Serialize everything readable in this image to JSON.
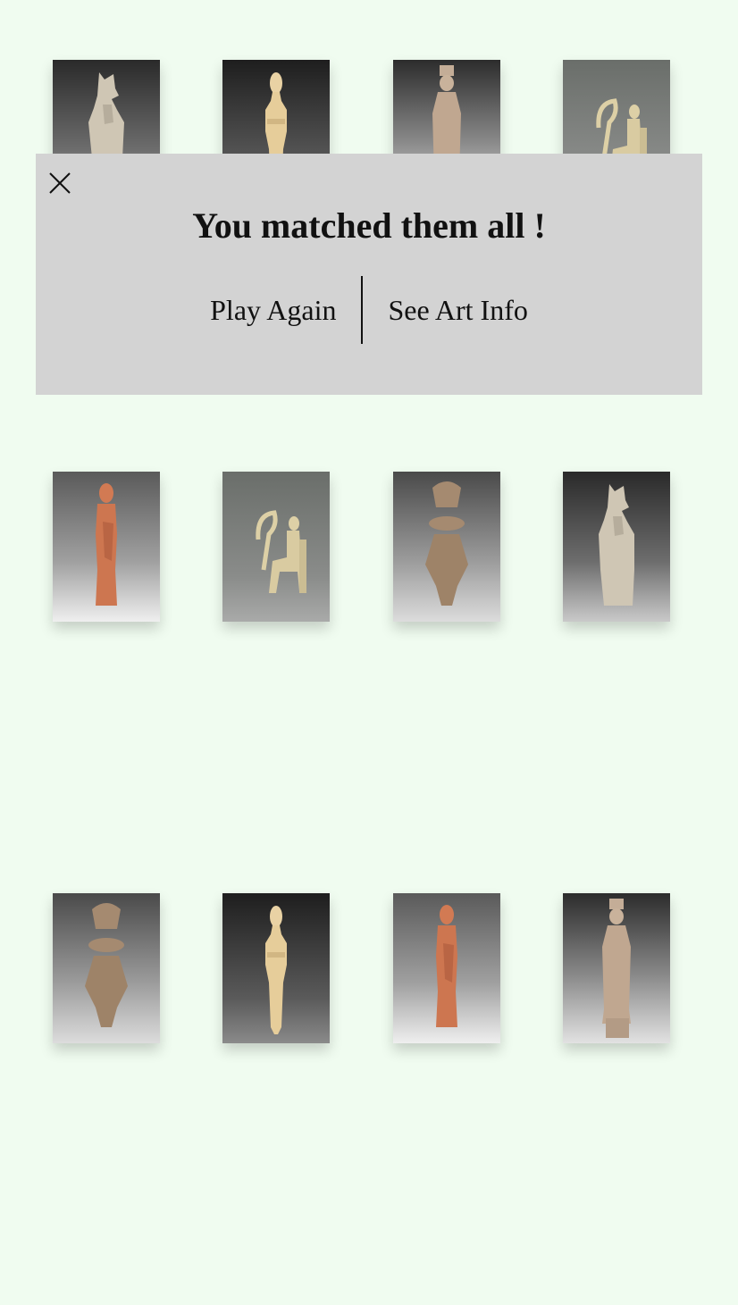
{
  "modal": {
    "title": "You matched them all !",
    "play_again_label": "Play Again",
    "art_info_label": "See Art Info",
    "close_icon": "close-icon"
  },
  "colors": {
    "page_background": "#f0fcf0",
    "modal_background": "#d3d3d3",
    "text": "#111111"
  },
  "cards": [
    {
      "row": 0,
      "col": 0,
      "figure": "horse-head-figure",
      "material": "limestone",
      "backdrop": "dark"
    },
    {
      "row": 0,
      "col": 1,
      "figure": "cycladic-figure",
      "material": "marble",
      "backdrop": "dark"
    },
    {
      "row": 0,
      "col": 2,
      "figure": "standing-woman-with-polos",
      "material": "limestone",
      "backdrop": "dark"
    },
    {
      "row": 0,
      "col": 3,
      "figure": "seated-harp-player",
      "material": "marble",
      "backdrop": "grey"
    },
    {
      "row": 1,
      "col": 0,
      "figure": "terracotta-standing-figure",
      "material": "terracotta",
      "backdrop": "mid"
    },
    {
      "row": 1,
      "col": 1,
      "figure": "seated-harp-player",
      "material": "marble",
      "backdrop": "grey"
    },
    {
      "row": 1,
      "col": 2,
      "figure": "goddess-with-headdress",
      "material": "clay",
      "backdrop": "mid"
    },
    {
      "row": 1,
      "col": 3,
      "figure": "horse-head-figure",
      "material": "limestone",
      "backdrop": "dark"
    },
    {
      "row": 2,
      "col": 0,
      "figure": "goddess-with-headdress",
      "material": "clay",
      "backdrop": "mid"
    },
    {
      "row": 2,
      "col": 1,
      "figure": "cycladic-figure",
      "material": "marble",
      "backdrop": "dark"
    },
    {
      "row": 2,
      "col": 2,
      "figure": "terracotta-standing-figure",
      "material": "terracotta",
      "backdrop": "mid"
    },
    {
      "row": 2,
      "col": 3,
      "figure": "standing-woman-with-polos",
      "material": "limestone",
      "backdrop": "dark"
    }
  ]
}
